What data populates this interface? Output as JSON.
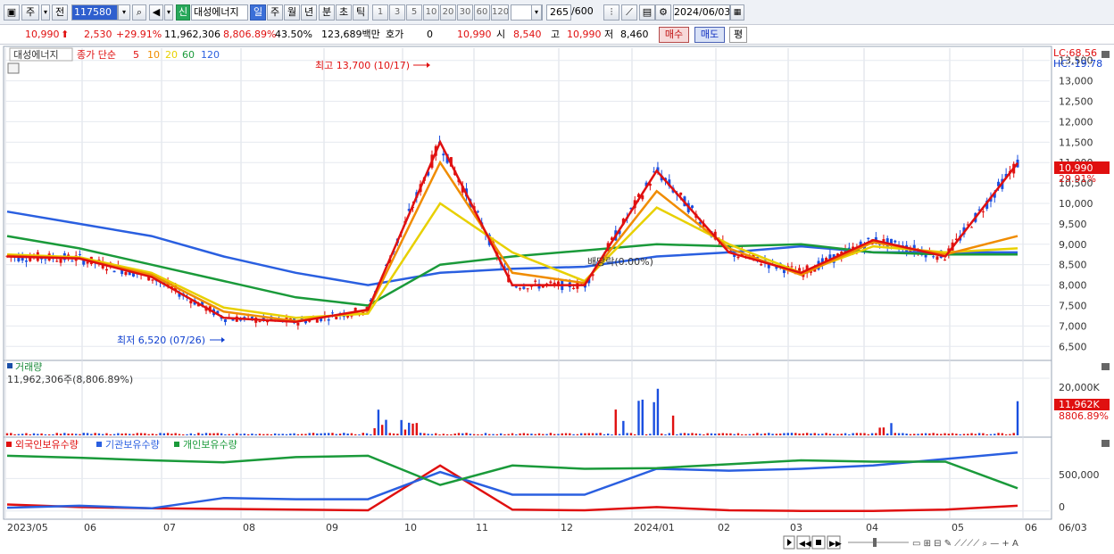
{
  "toolbar": {
    "period_short": "주",
    "period_prev": "전",
    "stock_code": "117580",
    "credit_label": "신",
    "stock_name": "대성에너지",
    "periods": [
      "일",
      "주",
      "월",
      "년",
      "분",
      "초",
      "틱"
    ],
    "active_period": "일",
    "intervals": [
      "1",
      "3",
      "5",
      "10",
      "20",
      "30",
      "60",
      "120"
    ],
    "count": "265",
    "count_total": "/600",
    "date": "2024/06/03"
  },
  "quote": {
    "price": "10,990",
    "change": "2,530",
    "change_pct": "+29.91%",
    "volume": "11,962,306",
    "volume_ratio": "8,806.89%",
    "turnover": "43.50%",
    "amount": "123,689백만",
    "hoga_label": "호가",
    "hoga_value": "0",
    "current": "10,990",
    "open_label": "시",
    "open": "8,540",
    "high_label": "고",
    "high": "10,990",
    "low_label": "저",
    "low": "8,460",
    "buy_label": "매수",
    "sell_label": "매도",
    "avg_label": "평"
  },
  "price_panel": {
    "legend_name": "대성에너지",
    "legend_ma_prefix": "종가 단순",
    "ma_periods": [
      {
        "label": "5",
        "color": "#e01010"
      },
      {
        "label": "10",
        "color": "#f08c00"
      },
      {
        "label": "20",
        "color": "#e8d000"
      },
      {
        "label": "60",
        "color": "#1a9a3a"
      },
      {
        "label": "120",
        "color": "#2a5fe0"
      }
    ],
    "lc_label": "LC:68.56",
    "hc_label": "HC:-19.78",
    "high_annotation": "최고 13,700 (10/17)",
    "low_annotation": "최저 6,520 (07/26)",
    "dividend_annotation": "배당락(0.00%)",
    "current_price_tag": "10,990",
    "current_pct_tag": "29.91%"
  },
  "volume_panel": {
    "title": "거래량",
    "value_label": "11,962,306주(8,806.89%)",
    "axis_tick": "20,000K",
    "current_tag": "11,962K",
    "current_pct_tag": "8806.89%"
  },
  "holding_panel": {
    "legend": [
      {
        "label": "외국인보유수량",
        "color": "#e01010"
      },
      {
        "label": "기관보유수량",
        "color": "#2a5fe0"
      },
      {
        "label": "개인보유수량",
        "color": "#1a9a3a"
      }
    ],
    "axis_ticks": [
      "500,000",
      "0"
    ]
  },
  "x_axis": {
    "labels": [
      "2023/05",
      "06",
      "07",
      "08",
      "09",
      "10",
      "11",
      "12",
      "2024/01",
      "02",
      "03",
      "04",
      "05",
      "06"
    ],
    "right_label": "06/03"
  },
  "chart_data": [
    {
      "type": "line",
      "title": "대성에너지",
      "subtitle": "종가 단순 5 10 20 60 120",
      "x": [
        "2023/05",
        "06",
        "07",
        "08",
        "09",
        "10",
        "11",
        "12",
        "2024/01",
        "02",
        "03",
        "04",
        "05",
        "06"
      ],
      "ylim": [
        6200,
        13800
      ],
      "y_ticks": [
        6500,
        7000,
        7500,
        8000,
        8500,
        9000,
        9500,
        10000,
        10500,
        11000,
        11500,
        12000,
        12500,
        13000,
        13500
      ],
      "series": [
        {
          "name": "5",
          "values": [
            8700,
            8650,
            8200,
            7200,
            7100,
            7400,
            11500,
            8000,
            8000,
            10800,
            8800,
            8300,
            9100,
            8700,
            10990
          ]
        },
        {
          "name": "10",
          "values": [
            8720,
            8660,
            8250,
            7350,
            7120,
            7380,
            11000,
            8300,
            8050,
            10300,
            8900,
            8250,
            9050,
            8750,
            9200
          ]
        },
        {
          "name": "20",
          "values": [
            8750,
            8680,
            8300,
            7450,
            7200,
            7300,
            10000,
            8800,
            8100,
            9900,
            9000,
            8300,
            8950,
            8800,
            8900
          ]
        },
        {
          "name": "60",
          "values": [
            9200,
            8900,
            8500,
            8100,
            7700,
            7500,
            8500,
            8700,
            8850,
            9000,
            8950,
            9000,
            8800,
            8750,
            8750
          ]
        },
        {
          "name": "120",
          "values": [
            9800,
            9500,
            9200,
            8700,
            8300,
            8000,
            8300,
            8400,
            8450,
            8700,
            8800,
            8950,
            8800,
            8800,
            8800
          ]
        }
      ],
      "annotations": [
        "최고 13,700 (10/17)",
        "최저 6,520 (07/26)",
        "배당락(0.00%)"
      ],
      "grid": true
    },
    {
      "type": "bar",
      "title": "거래량",
      "x": [
        "2023/05",
        "06",
        "07",
        "08",
        "09",
        "10",
        "11",
        "12",
        "2024/01",
        "02",
        "03",
        "04",
        "05",
        "06"
      ],
      "ylim": [
        0,
        25000
      ],
      "y_ticks": [
        20000
      ],
      "unit": "K",
      "latest_value": 11962
    },
    {
      "type": "line",
      "title": "외국인보유수량 기관보유수량 개인보유수량",
      "ylim": [
        -100000,
        1000000
      ],
      "y_ticks": [
        0,
        500000
      ],
      "series": [
        {
          "name": "외국인보유수량",
          "values": [
            100000,
            60000,
            40000,
            30000,
            20000,
            10000,
            700000,
            20000,
            10000,
            60000,
            10000,
            0,
            0,
            20000,
            80000
          ]
        },
        {
          "name": "기관보유수량",
          "values": [
            50000,
            80000,
            40000,
            200000,
            180000,
            180000,
            600000,
            250000,
            250000,
            650000,
            620000,
            650000,
            700000,
            800000,
            900000
          ]
        },
        {
          "name": "개인보유수량",
          "values": [
            850000,
            820000,
            780000,
            750000,
            830000,
            850000,
            400000,
            700000,
            650000,
            660000,
            720000,
            780000,
            760000,
            760000,
            350000
          ]
        }
      ]
    }
  ]
}
